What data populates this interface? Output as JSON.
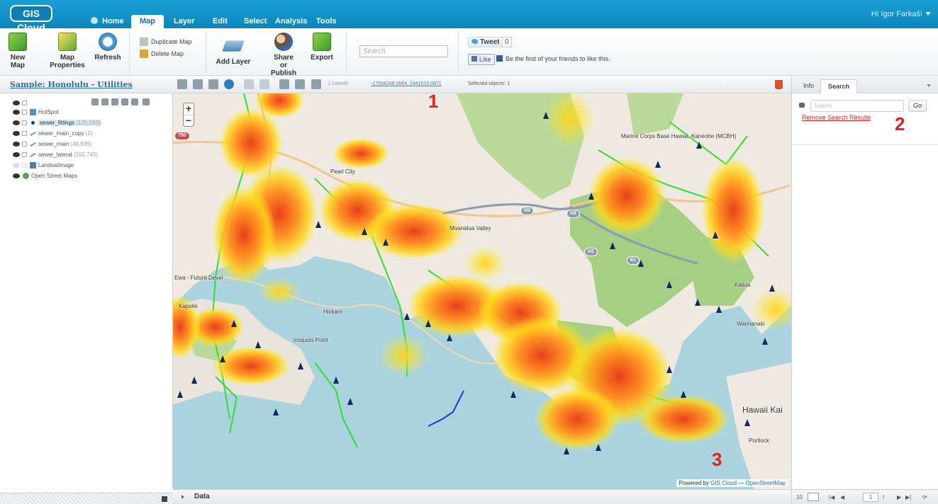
{
  "app": {
    "logo": "GIS Cloud",
    "user_greeting": "Hi Igor Farkaš!"
  },
  "menu_tabs": [
    {
      "label": "Home"
    },
    {
      "label": "Map"
    },
    {
      "label": "Layer"
    },
    {
      "label": "Edit"
    },
    {
      "label": "Select"
    },
    {
      "label": "Analysis"
    },
    {
      "label": "Tools"
    }
  ],
  "active_tab": "Map",
  "ribbon": {
    "new_map": "New Map",
    "map_properties_1": "Map",
    "map_properties_2": "Properties",
    "refresh": "Refresh",
    "duplicate_map": "Duplicate Map",
    "delete_map": "Delete Map",
    "add_layer": "Add Layer",
    "share_1": "Share or",
    "share_2": "Publish",
    "export": "Export",
    "search_placeholder": "Search",
    "tweet": "Tweet",
    "tweet_count": "0",
    "like": "Like",
    "fb_text": "Be the first of your friends to like this."
  },
  "toolbar": {
    "map_title": "Sample: Honolulu - Utilities",
    "scale": "1:144448",
    "coordinates": "-17564288.3664, 2441816.0871",
    "selected_objects": "Selected objects: 1"
  },
  "panel_tabs": [
    {
      "label": "Info"
    },
    {
      "label": "Search"
    }
  ],
  "active_panel_tab": "Search",
  "layers": [
    {
      "name": "HotSpot",
      "count": "",
      "visible": true,
      "icon": "database-icon"
    },
    {
      "name": "sewer_fittings",
      "count": "(120,150)",
      "visible": true,
      "icon": "point-icon",
      "selected": true
    },
    {
      "name": "sewer_main_copy",
      "count": "(1)",
      "visible": true,
      "icon": "line-icon"
    },
    {
      "name": "sewer_main",
      "count": "(49,835)",
      "visible": true,
      "icon": "line-icon"
    },
    {
      "name": "sewer_lateral",
      "count": "(155,745)",
      "visible": true,
      "icon": "line-icon"
    },
    {
      "name": "Landsatimage",
      "count": "",
      "visible": false,
      "icon": "image-icon"
    },
    {
      "name": "Open Street Maps",
      "count": "",
      "visible": true,
      "icon": "globe-icon"
    }
  ],
  "map": {
    "labels": {
      "pearl_city": "Pearl City",
      "marine_corps": "Marine Corps Base Hawaii, Kaneohe (MCBH)",
      "moanalua": "Moanalua Valley",
      "ewa": "Ewa - Future Devel",
      "kapolei": "Kapolei",
      "hickam": "Hickam",
      "iroquois": "Iroquois Point",
      "hawaii_kai": "Hawaii Kai",
      "waimanalo": "Waimanalo",
      "kailua": "Kailua",
      "portlock": "Portlock"
    },
    "routes": {
      "h3a": "H3",
      "h3b": "H3",
      "h1": "H1",
      "r750": "750",
      "r61": "61"
    },
    "attribution_prefix": "Powered by",
    "attribution_gis": "GIS Cloud",
    "attribution_dash": "—",
    "attribution_osm": "OpenStreetMap"
  },
  "annotations": {
    "a1": "1",
    "a2": "2",
    "a3": "3"
  },
  "search_panel": {
    "placeholder": "Search",
    "go": "Go",
    "remove_results": "Remove Search Results"
  },
  "data_bar": {
    "label": "Data"
  },
  "pager": {
    "page_size": "10",
    "page": "1",
    "separator": "/"
  },
  "colors": {
    "topbar": "#0b86bd",
    "heat_core": "#e8401a",
    "heat_edge": "#ffe21a",
    "sewer_line": "#2de02d",
    "annotation": "#e12020"
  }
}
